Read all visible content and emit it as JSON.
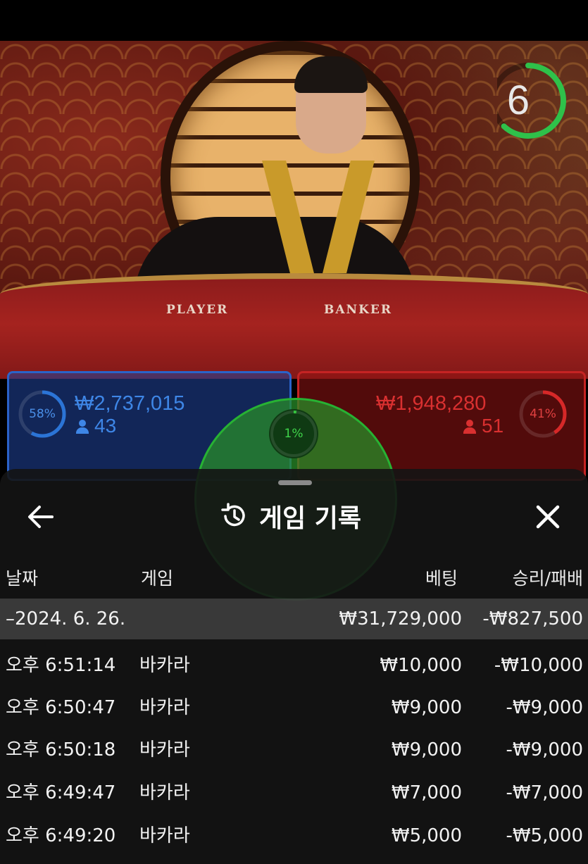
{
  "video": {
    "table_label_player": "PLAYER",
    "table_label_banker": "BANKER",
    "timer": "6",
    "timer_fraction": 0.62
  },
  "bets": {
    "player": {
      "percent": "58%",
      "percent_value": 0.58,
      "amount": "₩2,737,015",
      "count": "43",
      "color": "#2b74d6"
    },
    "tie": {
      "percent": "1%",
      "percent_value": 0.01,
      "color": "#35c43f"
    },
    "banker": {
      "percent": "41%",
      "percent_value": 0.41,
      "amount": "₩1,948,280",
      "count": "51",
      "color": "#d62828"
    }
  },
  "history_sheet": {
    "title": "게임 기록",
    "back_icon": "arrow-left-icon",
    "history_icon": "history-clock-icon",
    "close_icon": "close-icon",
    "columns": {
      "date": "날짜",
      "game": "게임",
      "bet": "베팅",
      "result": "승리/패배"
    },
    "summary": {
      "date": "–2024. 6. 26.",
      "bet": "₩31,729,000",
      "result": "-₩827,500"
    },
    "rows": [
      {
        "time": "오후 6:51:14",
        "game": "바카라",
        "bet": "₩10,000",
        "result": "-₩10,000"
      },
      {
        "time": "오후 6:50:47",
        "game": "바카라",
        "bet": "₩9,000",
        "result": "-₩9,000"
      },
      {
        "time": "오후 6:50:18",
        "game": "바카라",
        "bet": "₩9,000",
        "result": "-₩9,000"
      },
      {
        "time": "오후 6:49:47",
        "game": "바카라",
        "bet": "₩7,000",
        "result": "-₩7,000"
      },
      {
        "time": "오후 6:49:20",
        "game": "바카라",
        "bet": "₩5,000",
        "result": "-₩5,000"
      }
    ]
  }
}
